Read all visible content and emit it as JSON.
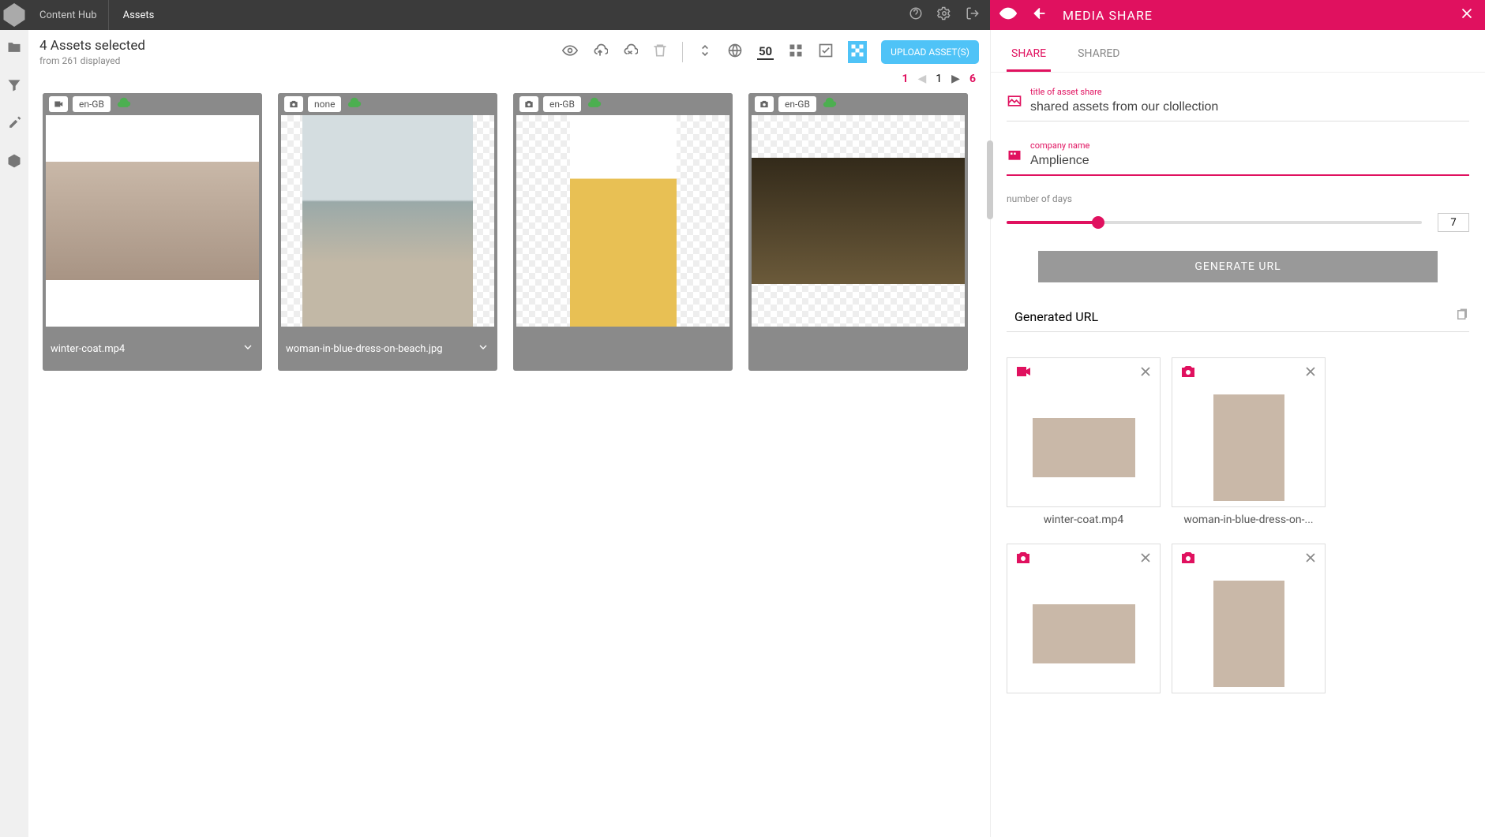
{
  "topbar": {
    "app_name": "Content Hub",
    "tab": "Assets"
  },
  "share_header": {
    "title": "MEDIA SHARE"
  },
  "toolbar": {
    "title": "4 Assets selected",
    "subtitle": "from 261 displayed",
    "page_size": "50",
    "upload_label": "UPLOAD ASSET(S)"
  },
  "pager": {
    "first": "1",
    "current": "1",
    "last": "6"
  },
  "assets": [
    {
      "type": "video",
      "locale": "en-GB",
      "name": "winter-coat.mp4",
      "checker": false,
      "imgclass": "portrait"
    },
    {
      "type": "photo",
      "locale": "none",
      "name": "woman-in-blue-dress-on-beach.jpg",
      "checker": true,
      "imgclass": "beach"
    },
    {
      "type": "photo",
      "locale": "en-GB",
      "name": "",
      "checker": true,
      "imgclass": "yellow-dress"
    },
    {
      "type": "photo",
      "locale": "en-GB",
      "name": "",
      "checker": true,
      "imgclass": "red-hat"
    }
  ],
  "share_panel": {
    "tabs": {
      "share": "SHARE",
      "shared": "SHARED"
    },
    "title_label": "title of asset share",
    "title_value": "shared assets from our clollection",
    "company_label": "company name",
    "company_value": "Amplience",
    "days_label": "number of days",
    "days_value": "7",
    "slider_pct": 22,
    "generate_label": "GENERATE URL",
    "generated_label": "Generated URL",
    "items": [
      {
        "type": "video",
        "label": "winter-coat.mp4",
        "thumbclass": ""
      },
      {
        "type": "photo",
        "label": "woman-in-blue-dress-on-...",
        "thumbclass": "tall"
      },
      {
        "type": "photo",
        "label": "",
        "thumbclass": ""
      },
      {
        "type": "photo",
        "label": "",
        "thumbclass": "tall"
      }
    ]
  }
}
